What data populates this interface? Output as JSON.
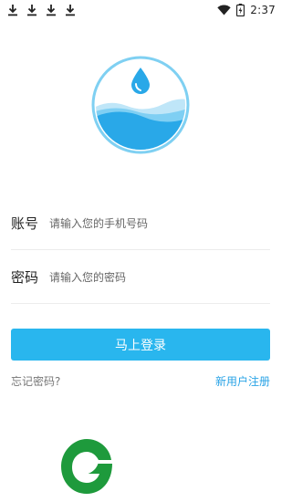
{
  "status_bar": {
    "time": "2:37",
    "icons": [
      "download-icon",
      "download-icon",
      "download-icon",
      "download-icon",
      "wifi-icon",
      "battery-charging-icon"
    ]
  },
  "logo": {
    "icon": "water-drop-wave-icon",
    "accent": "#29a8e8"
  },
  "form": {
    "account_label": "账号",
    "account_placeholder": "请输入您的手机号码",
    "password_label": "密码",
    "password_placeholder": "请输入您的密码"
  },
  "actions": {
    "login_label": "马上登录",
    "forgot_label": "忘记密码?",
    "register_label": "新用户注册"
  },
  "colors": {
    "primary": "#29b6ee",
    "link": "#29a3e6",
    "brand_green": "#1e9a3c"
  },
  "brand": {
    "icon": "green-leaf-g-logo-icon"
  }
}
